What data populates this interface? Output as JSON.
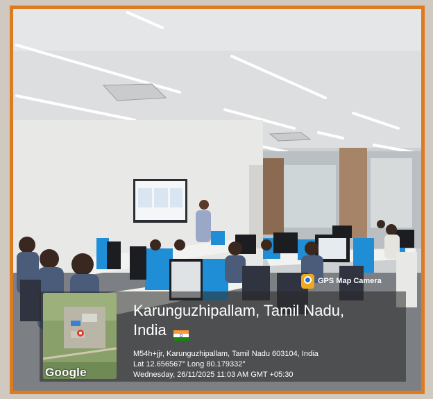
{
  "app_badge": {
    "label": "GPS Map Camera",
    "icon": "gps-map-camera-icon"
  },
  "location": {
    "title_line1": "Karunguzhipallam, Tamil Nadu,",
    "title_line2": "India",
    "flag": "india-flag-icon",
    "address": "M54h+jjr, Karunguzhipallam, Tamil Nadu 603104, India",
    "coords": "Lat 12.656567° Long 80.179332°",
    "datetime": "Wednesday, 26/11/2025 11:03 AM GMT +05:30"
  },
  "map": {
    "provider": "Google"
  },
  "colors": {
    "frame_border": "#e07a1f",
    "overlay": "#282828"
  }
}
